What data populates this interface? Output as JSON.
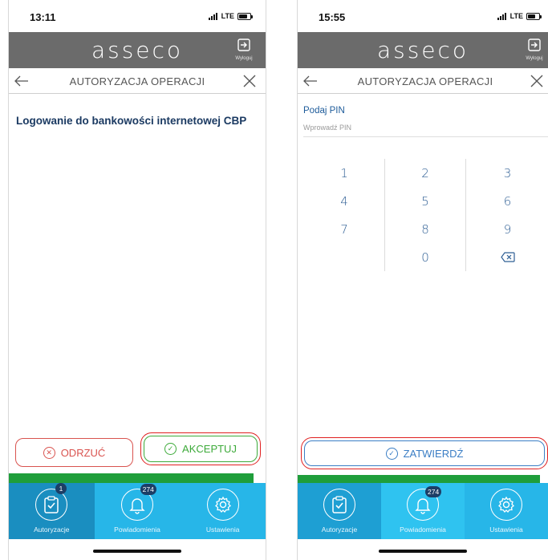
{
  "left": {
    "time": "13:11",
    "network": "LTE",
    "brand": "asseco",
    "logout_label": "Wyloguj",
    "title": "AUTORYZACJA OPERACJI",
    "operation_text": "Logowanie do bankowości internetowej CBP",
    "reject_label": "ODRZUĆ",
    "accept_label": "AKCEPTUJ",
    "nav": [
      {
        "label": "Autoryzacje",
        "badge": "1",
        "icon": "clipboard-check-icon"
      },
      {
        "label": "Powiadomienia",
        "badge": "274",
        "icon": "bell-icon"
      },
      {
        "label": "Ustawienia",
        "icon": "gear-icon"
      }
    ]
  },
  "right": {
    "time": "15:55",
    "network": "LTE",
    "brand": "asseco",
    "logout_label": "Wyloguj",
    "title": "AUTORYZACJA OPERACJI",
    "pin_label": "Podaj PIN",
    "pin_placeholder": "Wprowadź PIN",
    "keys": [
      "1",
      "2",
      "3",
      "4",
      "5",
      "6",
      "7",
      "8",
      "9",
      "",
      "0",
      "backspace-icon"
    ],
    "confirm_label": "ZATWIERDŹ",
    "nav": [
      {
        "label": "Autoryzacje",
        "icon": "clipboard-check-icon"
      },
      {
        "label": "Powiadomienia",
        "badge": "274",
        "icon": "bell-icon"
      },
      {
        "label": "Ustawienia",
        "icon": "gear-icon"
      }
    ]
  },
  "colors": {
    "brand_bar": "#6b6b6b",
    "nav_bar": "#27b6e8",
    "nav_active": "#1a8ec0",
    "reject": "#d9534f",
    "accept": "#3daa3a",
    "confirm": "#3b7ec5",
    "highlight": "#e02020",
    "green_strip": "#1f9e3b",
    "badge": "#1c3e66"
  }
}
